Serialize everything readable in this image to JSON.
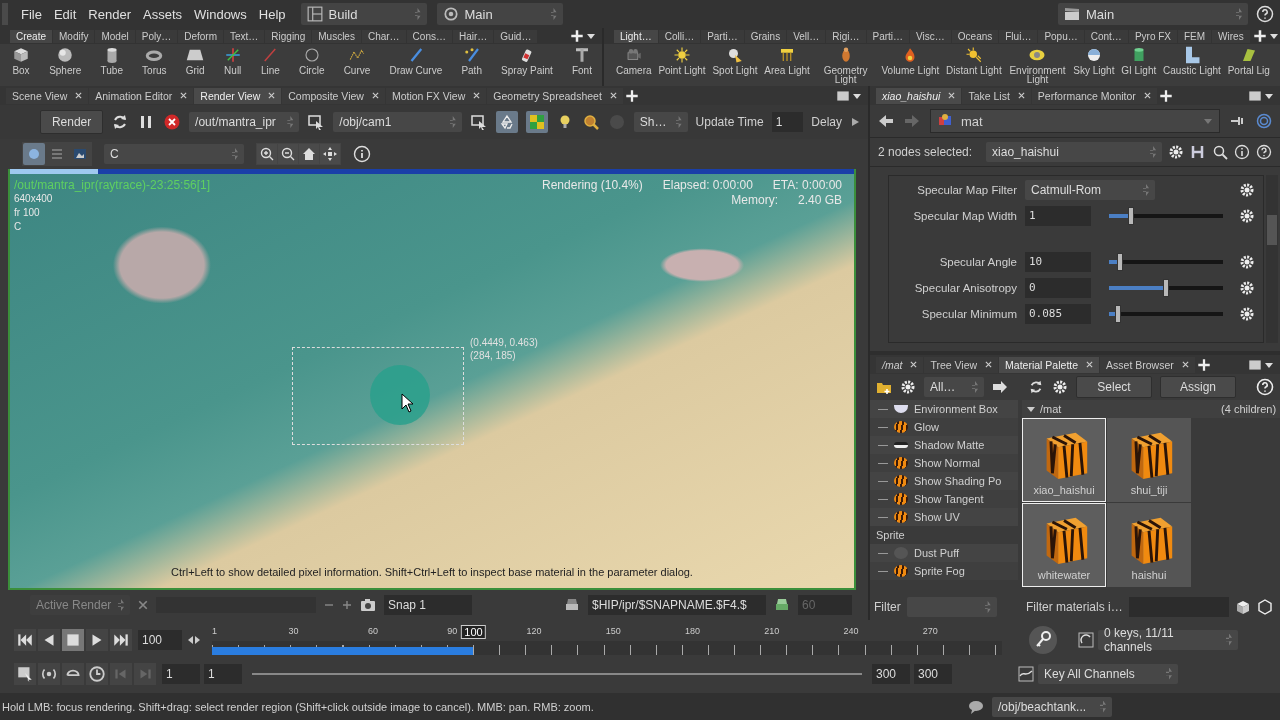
{
  "menu": [
    "File",
    "Edit",
    "Render",
    "Assets",
    "Windows",
    "Help"
  ],
  "desktop": {
    "label": "Build"
  },
  "main_menu": {
    "label": "Main"
  },
  "session": {
    "label": "Main"
  },
  "shelf_left": {
    "tabs": [
      {
        "label": "Create",
        "selected": true
      },
      {
        "label": "Modify",
        "selected": false
      },
      {
        "label": "Model",
        "selected": false
      },
      {
        "label": "Poly…",
        "selected": false
      },
      {
        "label": "Deform",
        "selected": false
      },
      {
        "label": "Text…",
        "selected": false
      },
      {
        "label": "Rigging",
        "selected": false
      },
      {
        "label": "Muscles",
        "selected": false
      },
      {
        "label": "Char…",
        "selected": false
      },
      {
        "label": "Cons…",
        "selected": false
      },
      {
        "label": "Hair…",
        "selected": false
      },
      {
        "label": "Guid…",
        "selected": false
      }
    ],
    "tools": [
      "Box",
      "Sphere",
      "Tube",
      "Torus",
      "Grid",
      "Null",
      "Line",
      "Circle",
      "Curve",
      "Draw Curve",
      "Path",
      "Spray Paint",
      "Font"
    ]
  },
  "shelf_right": {
    "tabs": [
      {
        "label": "Light…",
        "selected": true
      },
      {
        "label": "Colli…",
        "selected": false
      },
      {
        "label": "Parti…",
        "selected": false
      },
      {
        "label": "Grains",
        "selected": false
      },
      {
        "label": "Vell…",
        "selected": false
      },
      {
        "label": "Rigi…",
        "selected": false
      },
      {
        "label": "Parti…",
        "selected": false
      },
      {
        "label": "Visc…",
        "selected": false
      },
      {
        "label": "Oceans",
        "selected": false
      },
      {
        "label": "Flui…",
        "selected": false
      },
      {
        "label": "Popu…",
        "selected": false
      },
      {
        "label": "Cont…",
        "selected": false
      },
      {
        "label": "Pyro FX",
        "selected": false
      },
      {
        "label": "FEM",
        "selected": false
      },
      {
        "label": "Wires",
        "selected": false
      }
    ],
    "tools": [
      "Camera",
      "Point Light",
      "Spot Light",
      "Area Light",
      "Geometry Light",
      "Volume Light",
      "Distant Light",
      "Environment Light",
      "Sky Light",
      "GI Light",
      "Caustic Light",
      "Portal Lig"
    ]
  },
  "render_view": {
    "tabs": [
      {
        "label": "Scene View",
        "selected": false
      },
      {
        "label": "Animation Editor",
        "selected": false
      },
      {
        "label": "Render View",
        "selected": true
      },
      {
        "label": "Composite View",
        "selected": false
      },
      {
        "label": "Motion FX View",
        "selected": false
      },
      {
        "label": "Geometry Spreadsheet",
        "selected": false
      }
    ],
    "render_button": "Render",
    "driver": "/out/mantra_ipr",
    "camera": "/obj/cam1",
    "toggles": [
      {
        "selected": true
      },
      {
        "selected": true
      }
    ],
    "shading": "Sh…",
    "update_time_label": "Update Time",
    "update_time": "1",
    "delay_label": "Delay",
    "view_modes": [
      {
        "selected": true
      },
      {
        "selected": false
      },
      {
        "selected": false
      }
    ],
    "channel": "C"
  },
  "image": {
    "title": "/out/mantra_ipr(raytrace)-23:25:56[1]",
    "resolution": "640x400",
    "frame": "fr 100",
    "channel": "C",
    "status": "Rendering (10.4%)",
    "elapsed": "Elapsed: 0:00:00",
    "eta": "ETA: 0:00:00",
    "memory_label": "Memory:",
    "memory": "2.40 GB",
    "progress": {
      "level": 0.104
    },
    "region_uv": "(0.4449, 0.463)",
    "region_px": "(284, 185)",
    "hint": "Ctrl+Left to show detailed pixel information. Shift+Ctrl+Left to inspect base material in the parameter dialog."
  },
  "snapshot_bar": {
    "active_render": "Active Render",
    "snap": "Snap 1",
    "path": "$HIP/ipr/$SNAPNAME.$F4.$",
    "count": "60"
  },
  "parameters": {
    "tabs": [
      {
        "label": "xiao_haishui",
        "selected": true
      },
      {
        "label": "Take List",
        "selected": false
      },
      {
        "label": "Performance Monitor",
        "selected": false
      }
    ],
    "path": "mat",
    "selection_label": "2 nodes selected:",
    "node": "xiao_haishui",
    "params": [
      {
        "kind": "menu",
        "label": "Specular Map Filter",
        "value": "Catmull-Rom"
      },
      {
        "kind": "slider",
        "label": "Specular Map Width",
        "value": "1",
        "level": 0.19
      },
      {
        "kind": "slider",
        "label": "Specular Angle",
        "value": "10",
        "level": 0.1
      },
      {
        "kind": "slider",
        "label": "Specular Anisotropy",
        "value": "0",
        "level": 0.5
      },
      {
        "kind": "slider",
        "label": "Specular Minimum",
        "value": "0.085",
        "level": 0.08
      }
    ]
  },
  "material_palette": {
    "tabs": [
      {
        "label": "/mat",
        "selected": false
      },
      {
        "label": "Tree View",
        "selected": false
      },
      {
        "label": "Material Palette",
        "selected": true
      },
      {
        "label": "Asset Browser",
        "selected": false
      }
    ],
    "filter_dropdown": "All…",
    "tree": [
      {
        "children": [
          "Environment Box",
          "Glow",
          "Shadow Matte",
          "Show Normal",
          "Show Shading Po",
          "Show Tangent",
          "Show UV"
        ]
      },
      {
        "label": "Sprite",
        "children": [
          "Dust Puff",
          "Sprite Fog"
        ]
      }
    ],
    "filter_label": "Filter",
    "select_button": "Select",
    "assign_button": "Assign",
    "folder": "/mat",
    "count": "(4 children)",
    "materials": [
      {
        "name": "xiao_haishui",
        "selected": true
      },
      {
        "name": "shui_tiji",
        "selected": false
      },
      {
        "name": "whitewater",
        "selected": true
      },
      {
        "name": "haishui",
        "selected": false
      }
    ],
    "filter_materials_label": "Filter materials i…"
  },
  "timeline": {
    "current_frame": "100",
    "ticks": [
      "1",
      "30",
      "60",
      "90",
      "120",
      "150",
      "180",
      "210",
      "240",
      "270"
    ],
    "playhead": {
      "label": "100",
      "level": 0.331
    },
    "keys_info": "0 keys, 11/11 channels",
    "key_all": "Key All Channels",
    "range_start": "1",
    "range_start_2": "1",
    "range_end": "300",
    "range_end_2": "300"
  },
  "status_bar": {
    "message": "Hold LMB: focus rendering. Shift+drag: select render region (Shift+click outside image to cancel). MMB: pan. RMB: zoom.",
    "node_path": "/obj/beachtank..."
  }
}
